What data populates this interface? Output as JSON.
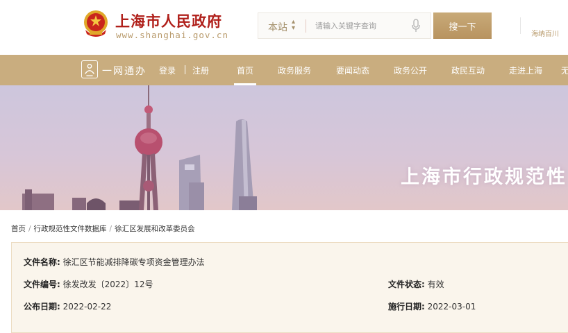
{
  "header": {
    "site_title": "上海市人民政府",
    "site_url": "www.shanghai.gov.cn",
    "search": {
      "scope": "本站",
      "placeholder": "请输入关键字查询",
      "button": "搜一下"
    },
    "right_text": "海纳百川"
  },
  "nav": {
    "ywtb": "一网通办",
    "login": "登录",
    "register": "注册",
    "items": [
      "首页",
      "政务服务",
      "要闻动态",
      "政务公开",
      "政民互动",
      "走进上海",
      "无"
    ],
    "active_index": 0
  },
  "banner": {
    "title": "上海市行政规范性"
  },
  "breadcrumb": [
    "首页",
    "行政规范性文件数据库",
    "徐汇区发展和改革委员会"
  ],
  "document": {
    "name_label": "文件名称:",
    "name": "徐汇区节能减排降碳专项资金管理办法",
    "number_label": "文件编号:",
    "number": "徐发改发〔2022〕12号",
    "status_label": "文件状态:",
    "status": "有效",
    "publish_label": "公布日期:",
    "publish_date": "2022-02-22",
    "effective_label": "施行日期:",
    "effective_date": "2022-03-01"
  },
  "colors": {
    "brand_red": "#b0201b",
    "gold": "#c9ad7f",
    "card_bg": "#faf5ec"
  }
}
